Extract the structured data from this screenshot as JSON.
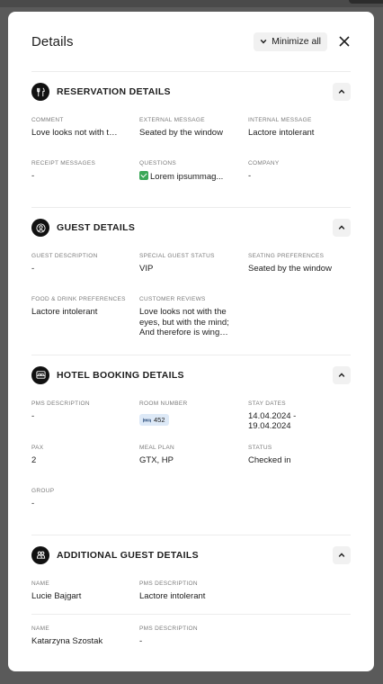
{
  "header": {
    "title": "Details",
    "minimize_label": "Minimize all"
  },
  "reservation": {
    "title": "RESERVATION DETAILS",
    "fields": [
      {
        "label": "COMMENT",
        "value": "Love looks not with the eyes, but with the mind"
      },
      {
        "label": "EXTERNAL MESSAGE",
        "value": "Seated by the window"
      },
      {
        "label": "INTERNAL MESSAGE",
        "value": "Lactore intolerant"
      },
      {
        "label": "RECEIPT MESSAGES",
        "value": "-"
      },
      {
        "label": "QUESTIONS",
        "value": "Lorem ipsummag..."
      },
      {
        "label": "COMPANY",
        "value": "-"
      }
    ]
  },
  "guest": {
    "title": "GUEST DETAILS",
    "fields": [
      {
        "label": "GUEST DESCRIPTION",
        "value": "-"
      },
      {
        "label": "SPECIAL GUEST STATUS",
        "value": "VIP"
      },
      {
        "label": "SEATING PREFERENCES",
        "value": "Seated by the window"
      },
      {
        "label": "FOOD & DRINK PREFERENCES",
        "value": "Lactore intolerant"
      },
      {
        "label": "CUSTOMER REVIEWS",
        "value": "Love looks not with the eyes, but with the mind; And therefore is wing'd Cupid painted..."
      }
    ]
  },
  "hotel": {
    "title": "HOTEL BOOKING DETAILS",
    "fields": [
      {
        "label": "PMS DESCRIPTION",
        "value": "-"
      },
      {
        "label": "ROOM NUMBER",
        "value": "452"
      },
      {
        "label": "STAY DATES",
        "value": "14.04.2024 - 19.04.2024"
      },
      {
        "label": "PAX",
        "value": "2"
      },
      {
        "label": "MEAL PLAN",
        "value": "GTX, HP"
      },
      {
        "label": "STATUS",
        "value": "Checked in"
      },
      {
        "label": "GROUP",
        "value": "-"
      }
    ]
  },
  "additional": {
    "title": "ADDITIONAL GUEST DETAILS",
    "guests": [
      {
        "name_label": "NAME",
        "name": "Lucie Bajgart",
        "pms_label": "PMS DESCRIPTION",
        "pms": "Lactore intolerant"
      },
      {
        "name_label": "NAME",
        "name": "Katarzyna Szostak",
        "pms_label": "PMS DESCRIPTION",
        "pms": "-"
      }
    ]
  }
}
